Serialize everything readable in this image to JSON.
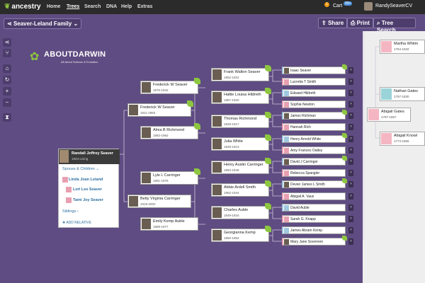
{
  "topbar": {
    "brand": "ancestry",
    "nav": [
      "Home",
      "Trees",
      "Search",
      "DNA",
      "Help",
      "Extras"
    ],
    "cart": "Cart",
    "cart_badge": "99+",
    "notif": "1",
    "user": "RandySeaverCV"
  },
  "toolbar": {
    "tree_name": "Seaver-Leland Family",
    "share": "Share",
    "print": "Print",
    "tree_search": "Tree Search"
  },
  "watermark": {
    "title": "ABOUTDARWIN",
    "subtitle": "All About Science & Evolution"
  },
  "focus": {
    "name": "Randall Jeffrey Seaver",
    "dates": "1943-Living",
    "spouse_label": "Spouse & Children",
    "spouse": "Linda Joan Leland",
    "children": [
      "Lori Lee Seaver",
      "Tami Joy Seaver"
    ],
    "siblings": "Siblings",
    "add_relative": "ADD RELATIVE"
  },
  "gen1": [
    {
      "name": "Frederick W Seaver",
      "dates": "1911-1983"
    },
    {
      "name": "Betty Virginia Carringer",
      "dates": "1919-2002"
    }
  ],
  "gen2": [
    {
      "name": "Frederick W Seaver",
      "dates": "1876-1942"
    },
    {
      "name": "Alma B Richmond",
      "dates": "1882-1962"
    },
    {
      "name": "Lyle L Carringer",
      "dates": "1891-1976"
    },
    {
      "name": "Emily Kemp Auble",
      "dates": "1899-1977"
    }
  ],
  "gen3": [
    {
      "name": "Frank Walton Seaver",
      "dates": "1852-1922"
    },
    {
      "name": "Hattie Louisa Hildreth",
      "dates": "1857-1920"
    },
    {
      "name": "Thomas Richmond",
      "dates": "1848-1917"
    },
    {
      "name": "Julia White",
      "dates": "1848-1913"
    },
    {
      "name": "Henry Austin Carringer",
      "dates": "1853-1946"
    },
    {
      "name": "Abbie Ardell Smith",
      "dates": "1862-1944"
    },
    {
      "name": "Charles Auble",
      "dates": "1849-1916"
    },
    {
      "name": "Georgianna Kemp",
      "dates": "1860-1952"
    }
  ],
  "gen4": [
    {
      "name": "Isaac Seaver"
    },
    {
      "name": "Lucretia T Smith"
    },
    {
      "name": "Edward Hildreth"
    },
    {
      "name": "Sophia Newton"
    },
    {
      "name": "James Richman"
    },
    {
      "name": "Hannah Rich"
    },
    {
      "name": "Henry Arnold White"
    },
    {
      "name": "Amy Frances Oatley"
    },
    {
      "name": "David J Carringer"
    },
    {
      "name": "Rebecca Spangler"
    },
    {
      "name": "Devier James L Smith"
    },
    {
      "name": "Abigail A. Vaux"
    },
    {
      "name": "David Auble"
    },
    {
      "name": "Sarah G. Knapp"
    },
    {
      "name": "James Abram Kemp"
    },
    {
      "name": "Mary Jane Sovereen"
    }
  ],
  "rightpanel": {
    "p1": {
      "name": "Martha Whitm",
      "dates": "1764-1832"
    },
    "p2": {
      "name": "Nathan Gates",
      "dates": "1767-1830"
    },
    "p3": {
      "name": "Abigail Gates",
      "dates": "1797-1867"
    },
    "p4": {
      "name": "Abigail Knowl",
      "dates": "1774-1855"
    }
  }
}
